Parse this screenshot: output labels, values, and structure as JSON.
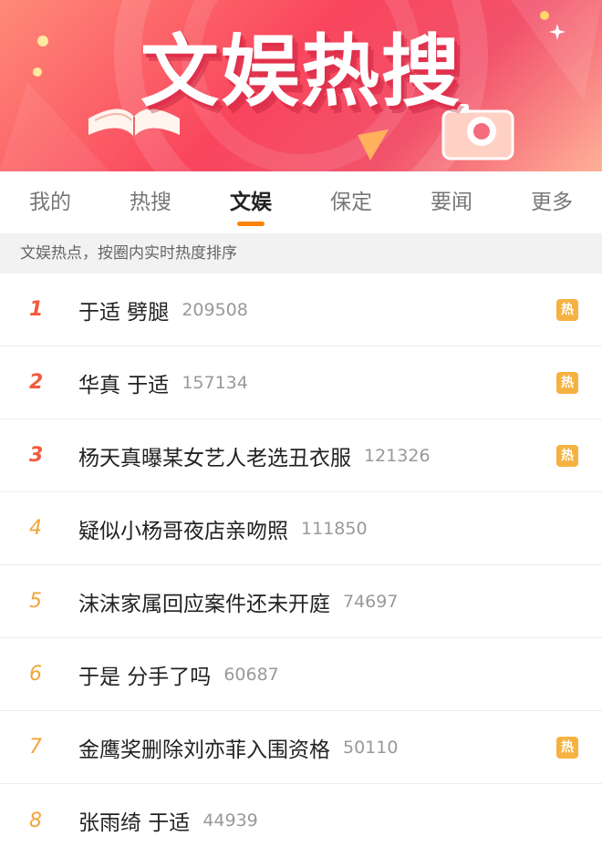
{
  "banner": {
    "title": "文娱热搜"
  },
  "tabs": [
    {
      "label": "我的"
    },
    {
      "label": "热搜"
    },
    {
      "label": "文娱",
      "active": true
    },
    {
      "label": "保定"
    },
    {
      "label": "要闻"
    },
    {
      "label": "更多"
    }
  ],
  "subheader": "文娱热点，按圈内实时热度排序",
  "hot_label": "热",
  "colors": {
    "accent": "#ff8200",
    "rank_top": "#f25a3d",
    "rank_other": "#f2a53d",
    "hot_badge": "#f6b241"
  },
  "items": [
    {
      "rank": "1",
      "title": "于适 劈腿",
      "count": "209508",
      "hot": true
    },
    {
      "rank": "2",
      "title": "华真 于适",
      "count": "157134",
      "hot": true
    },
    {
      "rank": "3",
      "title": "杨天真曝某女艺人老选丑衣服",
      "count": "121326",
      "hot": true
    },
    {
      "rank": "4",
      "title": "疑似小杨哥夜店亲吻照",
      "count": "111850",
      "hot": false
    },
    {
      "rank": "5",
      "title": "沫沫家属回应案件还未开庭",
      "count": "74697",
      "hot": false
    },
    {
      "rank": "6",
      "title": "于是 分手了吗",
      "count": "60687",
      "hot": false
    },
    {
      "rank": "7",
      "title": "金鹰奖删除刘亦菲入围资格",
      "count": "50110",
      "hot": true
    },
    {
      "rank": "8",
      "title": "张雨绮 于适",
      "count": "44939",
      "hot": false
    }
  ]
}
